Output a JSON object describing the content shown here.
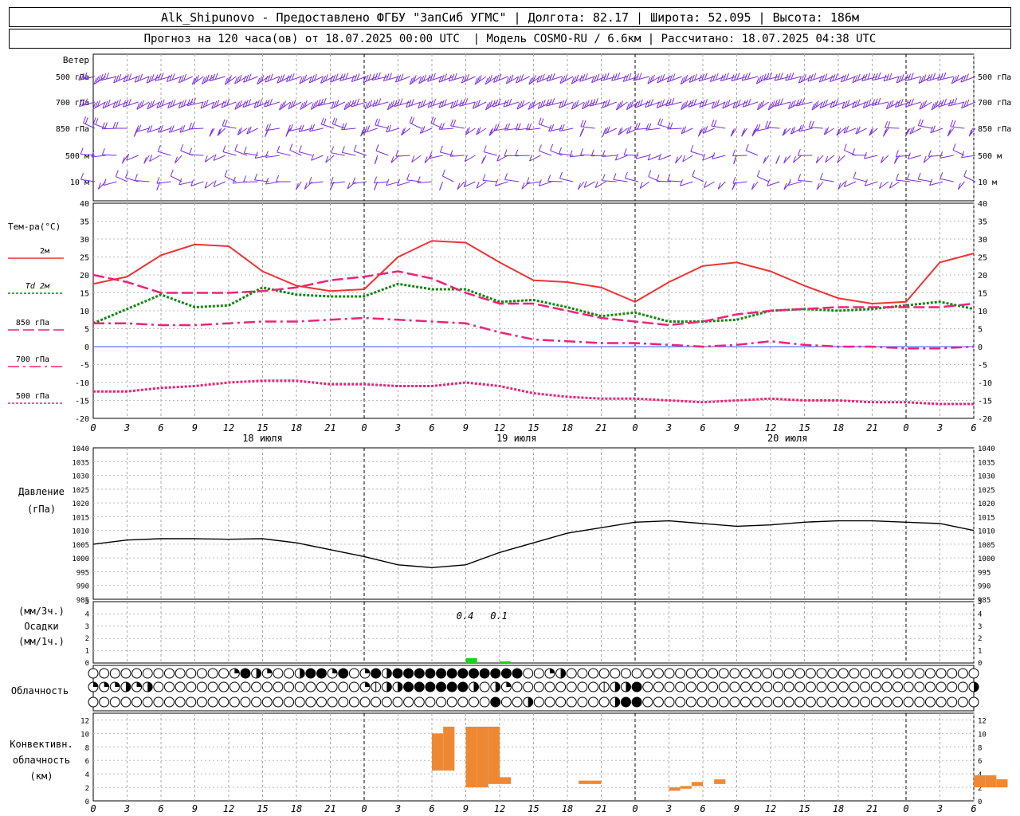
{
  "header": {
    "line1": "Alk_Shipunovo - Предоставлено ФГБУ \"ЗапСиб УГМС\" | Долгота: 82.17 | Широта: 52.095 | Высота: 186м",
    "line2": "Прогноз на 120 часа(ов) от 18.07.2025 00:00 UTC  | Модель COSMO-RU / 6.6км | Рассчитано: 18.07.2025 04:38 UTC"
  },
  "chart_data": {
    "type": "line",
    "time_axis": {
      "step_hours": 3,
      "tick_labels": [
        "0",
        "3",
        "6",
        "9",
        "12",
        "15",
        "18",
        "21",
        "0",
        "3",
        "6",
        "9",
        "12",
        "15",
        "18",
        "21",
        "0",
        "3",
        "6",
        "9",
        "12",
        "15",
        "18",
        "21",
        "0",
        "3",
        "6"
      ],
      "date_labels": [
        {
          "label": "18 июля",
          "tick": 5
        },
        {
          "label": "19 июля",
          "tick": 12.5
        },
        {
          "label": "20 июля",
          "tick": 20.5
        }
      ]
    },
    "panels": {
      "wind": {
        "title": "Ветер",
        "levels": [
          "500 гПа",
          "700 гПа",
          "850 гПа",
          "500 м",
          "10  м"
        ]
      },
      "temperature": {
        "title": "Тем-ра(°C)",
        "ylim": [
          -20,
          40
        ],
        "yticks": [
          "40",
          "35",
          "30",
          "25",
          "20",
          "15",
          "10",
          "5",
          "0",
          "-5",
          "-10",
          "-15",
          "-20"
        ],
        "series": [
          {
            "name": "2м",
            "color": "#ee3333",
            "style": "solid",
            "values": [
              17.5,
              19.5,
              25.5,
              28.5,
              28.0,
              21.0,
              17.0,
              15.5,
              16.0,
              25.0,
              29.5,
              29.0,
              23.5,
              18.5,
              18.0,
              16.5,
              12.5,
              18.0,
              22.5,
              23.5,
              21.0,
              17.0,
              13.5,
              12.0,
              12.5,
              23.5,
              26.0
            ]
          },
          {
            "name": "Td  2м",
            "color": "#118811",
            "style": "dotted",
            "values": [
              6.5,
              10.5,
              14.5,
              11.0,
              11.5,
              16.5,
              14.5,
              14.0,
              14.0,
              17.5,
              16.0,
              16.0,
              12.5,
              13.0,
              11.0,
              8.5,
              9.5,
              7.0,
              7.0,
              7.5,
              10.0,
              10.5,
              10.0,
              10.5,
              11.5,
              12.5,
              10.5
            ]
          },
          {
            "name": "850 гПа",
            "color": "#ee2277",
            "style": "longdash",
            "values": [
              20.0,
              18.0,
              15.0,
              15.0,
              15.0,
              15.5,
              16.5,
              18.5,
              19.5,
              21.0,
              19.0,
              15.0,
              12.0,
              12.0,
              10.0,
              8.0,
              7.0,
              6.0,
              7.0,
              9.0,
              10.0,
              10.5,
              11.0,
              11.0,
              11.0,
              11.0,
              12.0
            ]
          },
          {
            "name": "700 гПа",
            "color": "#ee2277",
            "style": "dashdot",
            "values": [
              6.5,
              6.5,
              6.0,
              6.0,
              6.5,
              7.0,
              7.0,
              7.5,
              8.0,
              7.5,
              7.0,
              6.5,
              4.0,
              2.0,
              1.5,
              1.0,
              1.0,
              0.5,
              0.0,
              0.5,
              1.5,
              0.5,
              0.0,
              0.0,
              -0.5,
              -0.5,
              0.0
            ]
          },
          {
            "name": "500 гПа",
            "color": "#ee2277",
            "style": "dotted",
            "values": [
              -12.5,
              -12.5,
              -11.5,
              -11.0,
              -10.0,
              -9.5,
              -9.5,
              -10.5,
              -10.5,
              -11.0,
              -11.0,
              -10.0,
              -11.0,
              -13.0,
              -14.0,
              -14.5,
              -14.5,
              -15.0,
              -15.5,
              -15.0,
              -14.5,
              -15.0,
              -15.0,
              -15.5,
              -15.5,
              -16.0,
              -16.0
            ]
          }
        ]
      },
      "pressure": {
        "title": "Давление",
        "unit": "(гПа)",
        "ylim": [
          985,
          1040
        ],
        "yticks": [
          "1040",
          "1035",
          "1030",
          "1025",
          "1020",
          "1015",
          "1010",
          "1005",
          "1000",
          "995",
          "990",
          "985"
        ],
        "values": [
          1005.0,
          1006.5,
          1007.0,
          1007.0,
          1006.8,
          1007.0,
          1005.5,
          1003.0,
          1000.5,
          997.5,
          996.5,
          997.5,
          1002.0,
          1005.5,
          1009.0,
          1011.0,
          1013.0,
          1013.5,
          1012.5,
          1011.5,
          1012.0,
          1013.0,
          1013.5,
          1013.5,
          1013.0,
          1012.5,
          1010.0
        ]
      },
      "precipitation": {
        "title": "Осадки",
        "unit3h": "(мм/3ч.)",
        "unit1h": "(мм/1ч.)",
        "ylim": [
          0,
          5
        ],
        "yticks": [
          "5",
          "4",
          "3",
          "2",
          "1",
          "0"
        ],
        "labels": [
          "0.4",
          "0.1"
        ],
        "bars": [
          {
            "hour": 33,
            "value": 0.4
          },
          {
            "hour": 36,
            "value": 0.1
          }
        ],
        "bar_color": "#22cc22"
      },
      "cloudiness": {
        "title": "Облачность",
        "rows": [
          [
            0,
            0,
            0,
            0,
            0,
            0,
            0,
            0,
            0,
            0,
            0,
            0,
            0,
            2,
            4,
            3,
            2,
            0,
            0,
            3,
            4,
            4,
            2,
            4,
            0,
            2,
            4,
            3,
            4,
            4,
            4,
            4,
            4,
            4,
            4,
            4,
            4,
            4,
            4,
            4,
            0,
            0,
            2,
            3,
            0,
            0,
            0,
            0,
            0,
            0,
            0,
            0,
            0,
            0,
            0,
            0,
            0,
            0,
            0,
            0,
            0,
            0,
            0,
            0,
            0,
            0,
            0,
            0,
            0,
            0,
            0,
            0,
            0,
            0,
            0,
            0,
            0,
            0,
            0,
            0,
            0,
            0
          ],
          [
            2,
            2,
            2,
            3,
            2,
            3,
            0,
            0,
            0,
            0,
            0,
            0,
            0,
            0,
            0,
            0,
            0,
            0,
            0,
            0,
            0,
            0,
            0,
            0,
            0,
            2,
            1,
            3,
            3,
            4,
            4,
            4,
            4,
            4,
            4,
            3,
            0,
            3,
            2,
            0,
            0,
            0,
            0,
            0,
            0,
            0,
            0,
            1,
            3,
            3,
            4,
            0,
            0,
            0,
            0,
            0,
            0,
            0,
            0,
            0,
            0,
            0,
            0,
            0,
            0,
            0,
            0,
            0,
            0,
            0,
            0,
            0,
            0,
            0,
            0,
            0,
            0,
            0,
            0,
            0,
            0,
            3
          ],
          [
            0,
            0,
            0,
            0,
            0,
            0,
            0,
            0,
            0,
            0,
            0,
            0,
            0,
            0,
            0,
            0,
            0,
            0,
            0,
            0,
            0,
            0,
            0,
            0,
            0,
            0,
            0,
            0,
            0,
            0,
            0,
            0,
            0,
            0,
            0,
            0,
            0,
            4,
            0,
            0,
            3,
            0,
            0,
            0,
            0,
            0,
            0,
            0,
            3,
            4,
            4,
            0,
            0,
            0,
            0,
            0,
            0,
            0,
            0,
            0,
            0,
            0,
            0,
            0,
            0,
            0,
            0,
            0,
            0,
            0,
            0,
            0,
            0,
            0,
            0,
            0,
            0,
            0,
            0,
            0,
            0,
            0
          ]
        ]
      },
      "convective": {
        "title": "Конвективн.",
        "title2": "облачность",
        "unit": "(км)",
        "ylim": [
          0,
          13
        ],
        "yticks": [
          "12",
          "10",
          "8",
          "6",
          "4",
          "2",
          "0"
        ],
        "bar_color": "#ee8833",
        "bars": [
          {
            "hour": 30,
            "base": 4.5,
            "top": 10.0
          },
          {
            "hour": 31,
            "base": 4.5,
            "top": 11.0
          },
          {
            "hour": 33,
            "base": 2.0,
            "top": 11.0
          },
          {
            "hour": 34,
            "base": 2.0,
            "top": 11.0
          },
          {
            "hour": 35,
            "base": 2.5,
            "top": 11.0
          },
          {
            "hour": 36,
            "base": 2.5,
            "top": 3.5
          },
          {
            "hour": 43,
            "base": 2.5,
            "top": 3.0
          },
          {
            "hour": 44,
            "base": 2.5,
            "top": 3.0
          },
          {
            "hour": 51,
            "base": 1.5,
            "top": 2.0
          },
          {
            "hour": 52,
            "base": 1.8,
            "top": 2.2
          },
          {
            "hour": 53,
            "base": 2.2,
            "top": 2.8
          },
          {
            "hour": 55,
            "base": 2.5,
            "top": 3.2
          },
          {
            "hour": 78,
            "base": 2.0,
            "top": 3.8
          },
          {
            "hour": 79,
            "base": 2.0,
            "top": 3.8
          },
          {
            "hour": 80,
            "base": 2.0,
            "top": 3.2
          }
        ]
      }
    }
  }
}
